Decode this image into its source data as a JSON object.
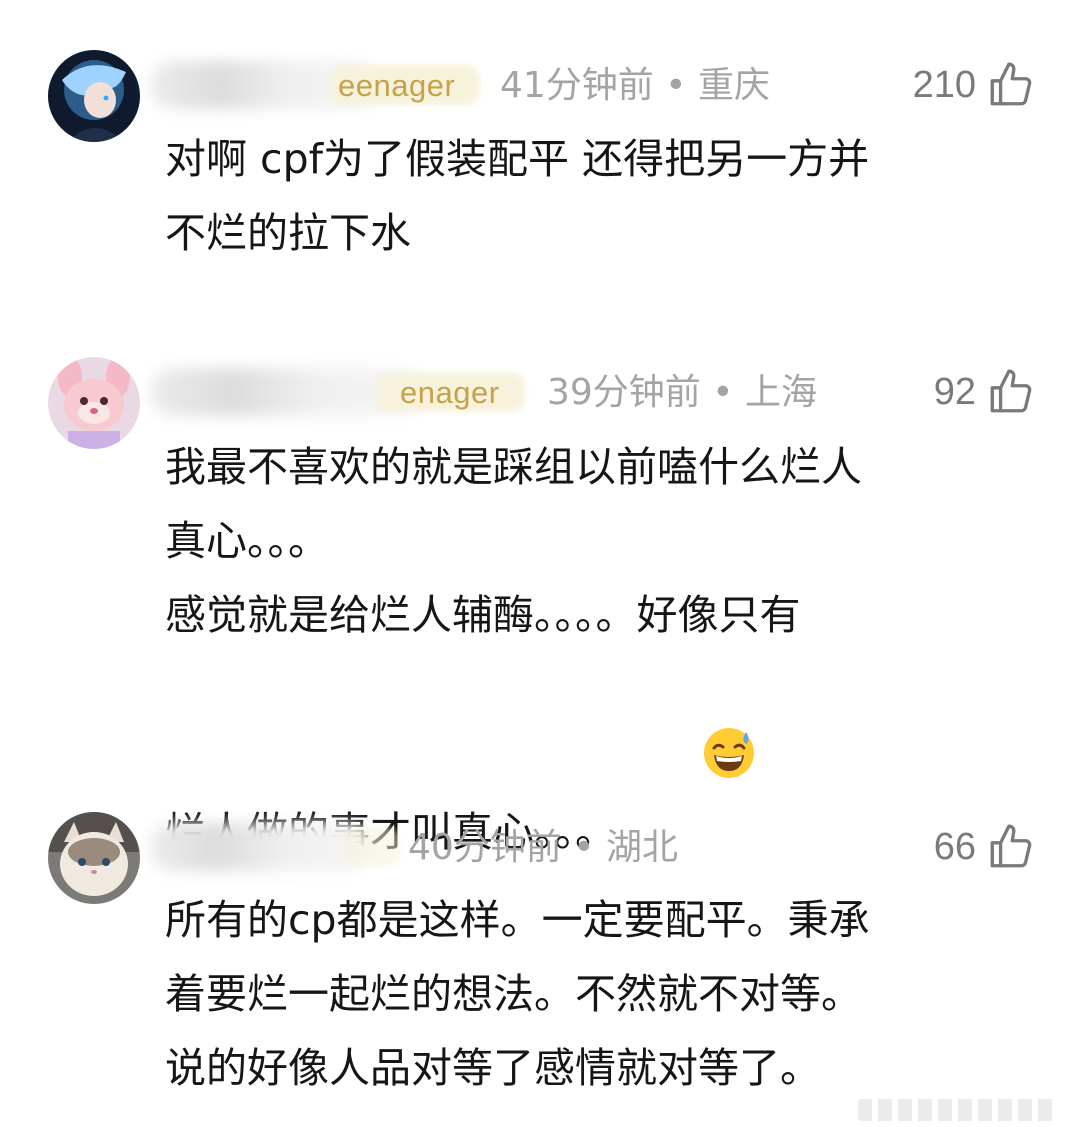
{
  "comments": [
    {
      "badge": "eenager",
      "time": "41分钟前",
      "location": "重庆",
      "likes": "210",
      "lines": [
        "对啊 cpf为了假装配平 还得把另一方并",
        "不烂的拉下水"
      ]
    },
    {
      "badge": "enager",
      "time": "39分钟前",
      "location": "上海",
      "likes": "92",
      "lines": [
        "我最不喜欢的就是踩组以前嗑什么烂人",
        "真心。。。",
        "感觉就是给烂人辅酶。。。。好像只有",
        "烂人做的事才叫真心。。。"
      ],
      "emoji": "grinning-sweat-emoji"
    },
    {
      "badge": "",
      "time": "40分钟前",
      "location": "湖北",
      "likes": "66",
      "lines": [
        "所有的cp都是这样。一定要配平。秉承",
        "着要烂一起烂的想法。不然就不对等。",
        "说的好像人品对等了感情就对等了。"
      ]
    }
  ],
  "separator": " • ",
  "colors": {
    "text": "#161616",
    "meta": "#a4a4a4",
    "badge": "#c7a24a",
    "like": "#7a7a7a"
  },
  "icons": {
    "like": "thumbs-up-icon"
  }
}
